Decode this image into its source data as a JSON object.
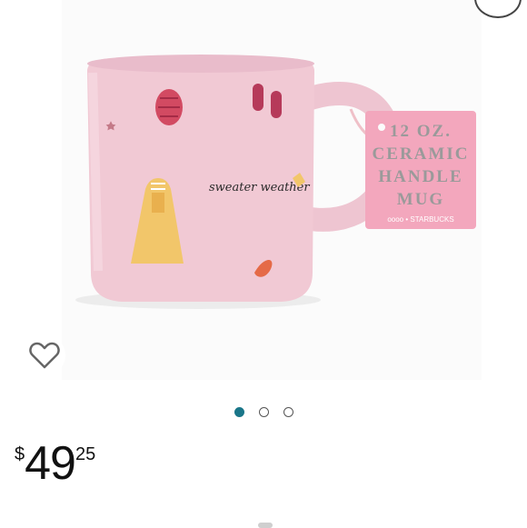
{
  "product_image": {
    "mug_print_text": "sweater weather",
    "tag": {
      "lines": [
        "12 OZ.",
        "CERAMIC",
        "HANDLE",
        "MUG"
      ],
      "brand": "oooo • STARBUCKS"
    },
    "colors": {
      "mug": "#f1c9d4",
      "tag": "#f3a7bd",
      "raincoat": "#f2c66a"
    }
  },
  "gallery": {
    "total": 3,
    "active": 1
  },
  "price": {
    "currency": "$",
    "whole": "49",
    "fraction": "25"
  },
  "icons": {
    "favorite": "heart-outline-icon",
    "share": "share-icon"
  },
  "accent_color": "#1a7689"
}
